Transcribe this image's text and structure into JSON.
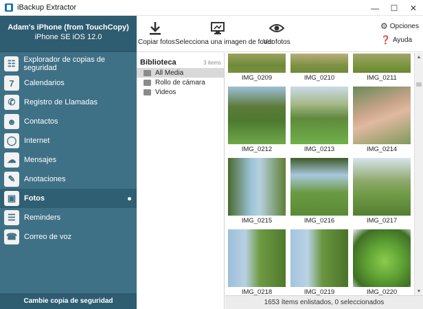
{
  "window": {
    "title": "iBackup Extractor"
  },
  "device": {
    "name": "Adam's iPhone (from TouchCopy)",
    "info": "iPhone SE iOS 12.0"
  },
  "sidebar": {
    "items": [
      {
        "label": "Explorador de copias de seguridad",
        "icon": "backup-explorer-icon"
      },
      {
        "label": "Calendarios",
        "icon": "calendar-icon"
      },
      {
        "label": "Registro de Llamadas",
        "icon": "phone-icon"
      },
      {
        "label": "Contactos",
        "icon": "contacts-icon"
      },
      {
        "label": "Internet",
        "icon": "internet-icon"
      },
      {
        "label": "Mensajes",
        "icon": "messages-icon"
      },
      {
        "label": "Anotaciones",
        "icon": "notes-icon"
      },
      {
        "label": "Fotos",
        "icon": "photos-icon",
        "active": true
      },
      {
        "label": "Reminders",
        "icon": "reminders-icon"
      },
      {
        "label": "Correo de voz",
        "icon": "voicemail-icon"
      }
    ],
    "footer": "Cambie copia de seguridad"
  },
  "toolbar": {
    "copy_photos": "Copiar fotos",
    "set_wallpaper": "Selecciona una imagen de fondo",
    "view_photos": "Ver fotos",
    "options": "Opciones",
    "help": "Ayuda"
  },
  "library": {
    "title": "Biblioteca",
    "count": "3 items",
    "items": [
      {
        "label": "All Media",
        "selected": true
      },
      {
        "label": "Rollo de cámara"
      },
      {
        "label": "Videos"
      }
    ]
  },
  "photos": [
    {
      "label": "IMG_0209"
    },
    {
      "label": "IMG_0210"
    },
    {
      "label": "IMG_0211"
    },
    {
      "label": "IMG_0212"
    },
    {
      "label": "IMG_0213"
    },
    {
      "label": "IMG_0214"
    },
    {
      "label": "IMG_0215"
    },
    {
      "label": "IMG_0216"
    },
    {
      "label": "IMG_0217"
    },
    {
      "label": "IMG_0218"
    },
    {
      "label": "IMG_0219"
    },
    {
      "label": "IMG_0220"
    }
  ],
  "status": "1653 ítems enlistados, 0 seleccionados",
  "colors": {
    "sidebar": "#3f7186",
    "sidebar_header": "#2e5c70",
    "accent": "#2f5f73"
  }
}
